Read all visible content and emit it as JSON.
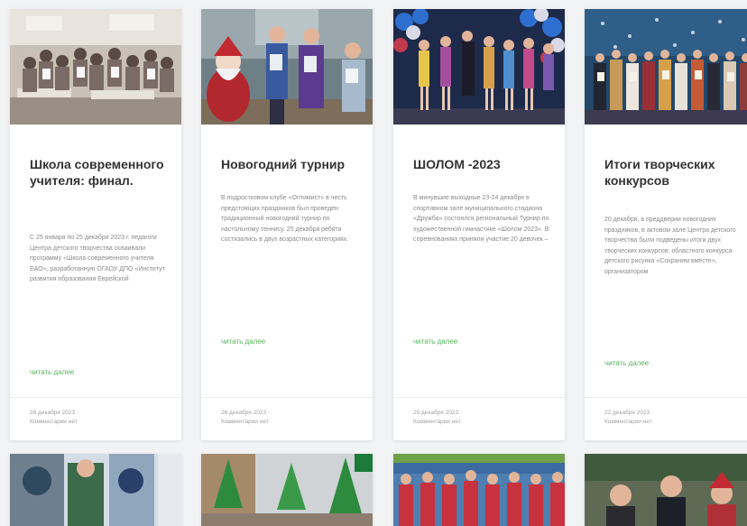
{
  "posts": [
    {
      "title": "Школа современного учителя: финал.",
      "excerpt": "С 25 января по 25 декабря 2023 г. педагоги Центра детского творчества осваивали программу «Школа современного учителя ЕАО», разработанную ОГАОУ ДПО «Институт развития образования Еврейской",
      "read_more": "читать далее",
      "date": "26 декабря 2023",
      "comments": "Комментарии нет"
    },
    {
      "title": "Новогодний турнир",
      "excerpt": "В подростковом клубе «Оптимист» в честь предстоящих праздников был проведен традиционный новогодний турнир по настольному теннису. 25 декабря ребята состязались в двух возрастных категориях.",
      "read_more": "читать далее",
      "date": "26 декабря 2023",
      "comments": "Комментарии нет"
    },
    {
      "title": "ШОЛОМ -2023",
      "excerpt": "В минувшие выходные 23-24 декабря в спортивном зале муниципального стадиона «Дружба» состоялся региональный Турнир по художественной гимнастике «Шолом 2023». В соревнованиях приняли участие 20 девочек –",
      "read_more": "читать далее",
      "date": "25 декабря 2023",
      "comments": "Комментарии нет"
    },
    {
      "title": "Итоги творческих конкурсов",
      "excerpt": "20 декабря, в преддверии новогодних праздников, в актовом зале Центра детского творчества были подведены итоги двух творческих конкурсов: областного конкурса детского рисунка «Сохраним вместе», организатором",
      "read_more": "читать далее",
      "date": "22 декабря 2023",
      "comments": "Комментарии нет"
    }
  ]
}
